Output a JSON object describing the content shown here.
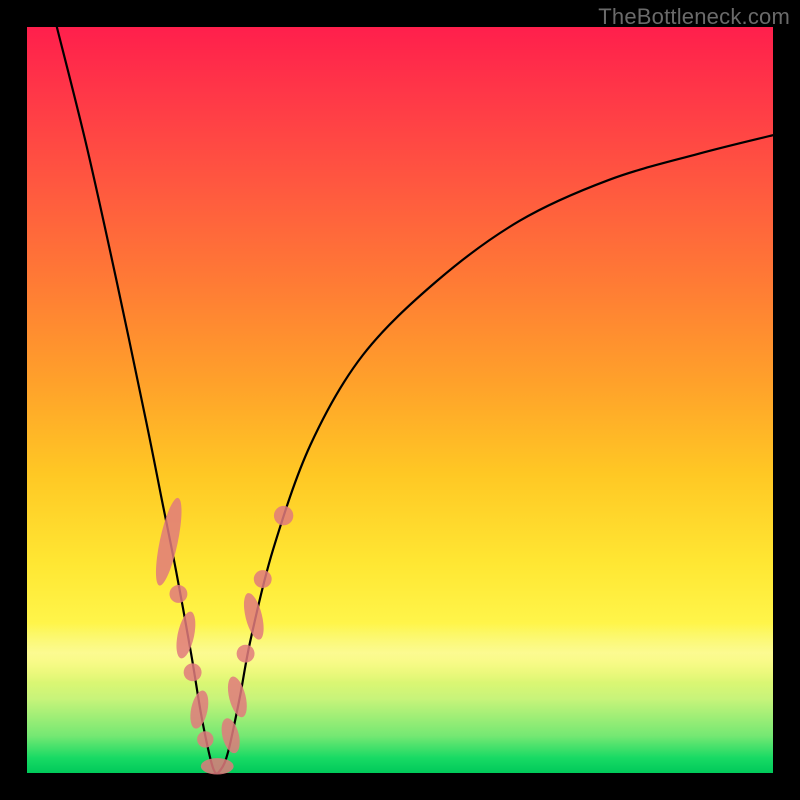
{
  "watermark": "TheBottleneck.com",
  "chart_data": {
    "type": "line",
    "title": "",
    "xlabel": "",
    "ylabel": "",
    "xlim": [
      0,
      100
    ],
    "ylim": [
      0,
      100
    ],
    "grid": false,
    "legend": false,
    "series": [
      {
        "name": "bottleneck-curve",
        "x": [
          4,
          8,
          12,
          16,
          18,
          20,
          22,
          23.5,
          25,
          26,
          27,
          28.5,
          30,
          33,
          38,
          45,
          55,
          66,
          78,
          90,
          100
        ],
        "y": [
          100,
          84,
          66,
          47,
          37,
          27,
          16,
          7,
          0.5,
          0.5,
          3,
          10,
          18,
          30,
          44,
          56,
          66,
          74,
          79.5,
          83,
          85.5
        ]
      }
    ],
    "markers": [
      {
        "name": "left-blob-upper",
        "shape": "pill",
        "cx": 19.0,
        "cy": 31,
        "rx": 1.2,
        "ry": 6
      },
      {
        "name": "left-blob-mid1",
        "shape": "circle",
        "cx": 20.3,
        "cy": 24,
        "r": 1.2
      },
      {
        "name": "left-blob-mid2",
        "shape": "pill",
        "cx": 21.3,
        "cy": 18.5,
        "rx": 1.1,
        "ry": 3.2
      },
      {
        "name": "left-blob-mid3",
        "shape": "circle",
        "cx": 22.2,
        "cy": 13.5,
        "r": 1.2
      },
      {
        "name": "left-blob-low1",
        "shape": "pill",
        "cx": 23.1,
        "cy": 8.5,
        "rx": 1.1,
        "ry": 2.6
      },
      {
        "name": "left-blob-low2",
        "shape": "circle",
        "cx": 23.9,
        "cy": 4.5,
        "r": 1.1
      },
      {
        "name": "bottom-blob",
        "shape": "pill-h",
        "cx": 25.5,
        "cy": 0.9,
        "rx": 2.2,
        "ry": 1.1
      },
      {
        "name": "right-blob-low1",
        "shape": "pill",
        "cx": 27.3,
        "cy": 5,
        "rx": 1.1,
        "ry": 2.4
      },
      {
        "name": "right-blob-low2",
        "shape": "pill",
        "cx": 28.2,
        "cy": 10.2,
        "rx": 1.1,
        "ry": 2.8
      },
      {
        "name": "right-blob-mid1",
        "shape": "circle",
        "cx": 29.3,
        "cy": 16,
        "r": 1.2
      },
      {
        "name": "right-blob-mid2",
        "shape": "pill",
        "cx": 30.4,
        "cy": 21,
        "rx": 1.1,
        "ry": 3.2
      },
      {
        "name": "right-blob-mid3",
        "shape": "circle",
        "cx": 31.6,
        "cy": 26,
        "r": 1.2
      },
      {
        "name": "right-blob-upper",
        "shape": "circle",
        "cx": 34.4,
        "cy": 34.5,
        "r": 1.3
      }
    ],
    "gradient_description": "vertical red→orange→yellow→green heatmap background indicating bottleneck severity"
  }
}
